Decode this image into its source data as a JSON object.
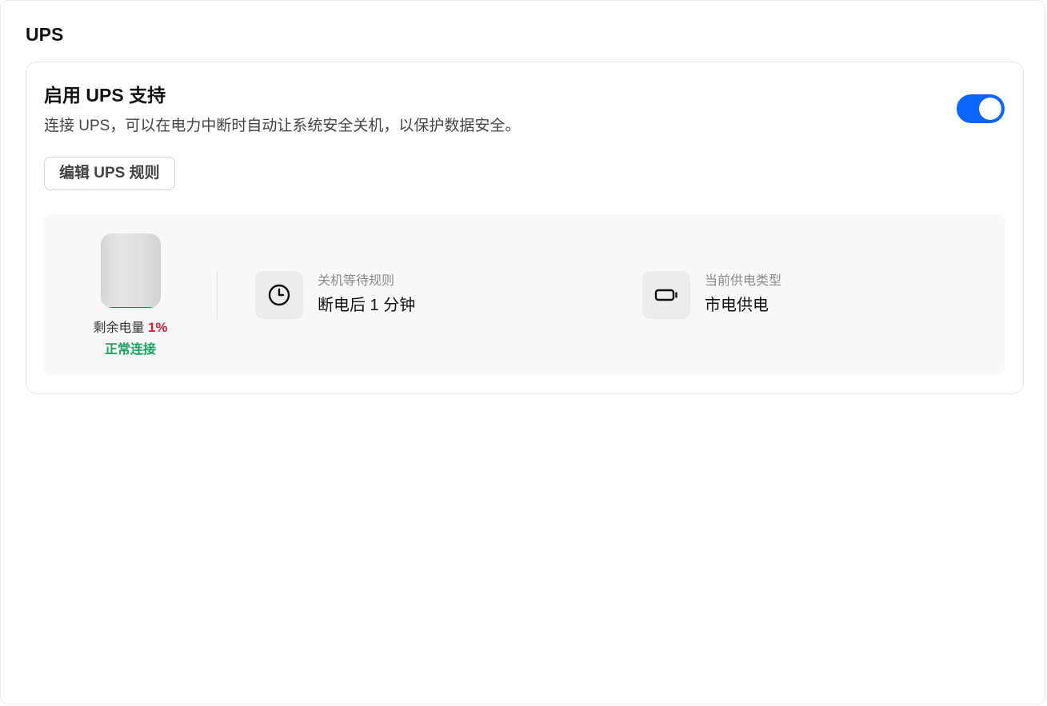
{
  "page": {
    "title": "UPS"
  },
  "ups_card": {
    "title": "启用 UPS 支持",
    "description": "连接 UPS，可以在电力中断时自动让系统安全关机，以保护数据安全。",
    "toggle_enabled": true,
    "edit_button_label": "编辑 UPS 规则"
  },
  "status": {
    "battery": {
      "label": "剩余电量",
      "percent_text": "1%",
      "level": 0.01,
      "fill_color": "#e0223a",
      "connection_status": "正常连接",
      "connection_color": "#1aa260"
    },
    "shutdown_rule": {
      "icon": "clock-icon",
      "label": "关机等待规则",
      "value": "断电后 1 分钟"
    },
    "power_type": {
      "icon": "battery-plug-icon",
      "label": "当前供电类型",
      "value": "市电供电"
    }
  },
  "colors": {
    "accent": "#0a64ff",
    "battery_low": "#d6203a",
    "connected": "#1aa260"
  }
}
